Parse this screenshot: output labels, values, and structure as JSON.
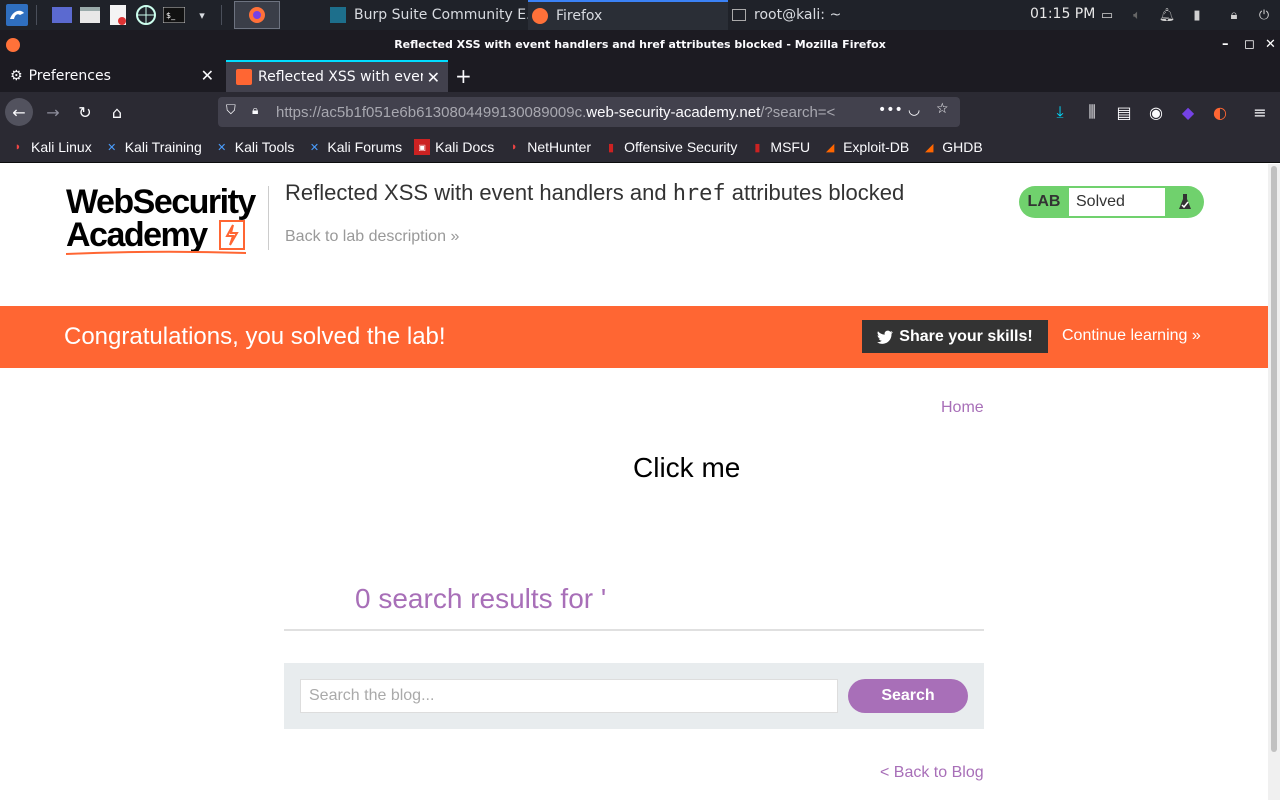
{
  "taskbar": {
    "tasks": [
      {
        "label": "Burp Suite Community E..."
      },
      {
        "label": "Firefox"
      },
      {
        "label": "root@kali: ~"
      }
    ],
    "clock": "01:15 PM"
  },
  "window": {
    "title": "Reflected XSS with event handlers and href attributes blocked - Mozilla Firefox"
  },
  "tabs": [
    {
      "label": "Preferences"
    },
    {
      "label": "Reflected XSS with event"
    }
  ],
  "urlbar": {
    "prefix": "https://ac5b1f051e6b6130804499130089009c.",
    "host": "web-security-academy.net",
    "suffix": "/?search=<"
  },
  "bookmarks": [
    {
      "label": "Kali Linux"
    },
    {
      "label": "Kali Training"
    },
    {
      "label": "Kali Tools"
    },
    {
      "label": "Kali Forums"
    },
    {
      "label": "Kali Docs"
    },
    {
      "label": "NetHunter"
    },
    {
      "label": "Offensive Security"
    },
    {
      "label": "MSFU"
    },
    {
      "label": "Exploit-DB"
    },
    {
      "label": "GHDB"
    }
  ],
  "header": {
    "logo_line1": "WebSecurity",
    "logo_line2": "Academy",
    "title_part1": "Reflected XSS with event handlers and ",
    "title_code": "href",
    "title_part2": " attributes blocked",
    "back_description": "Back to lab description",
    "lab_label": "LAB",
    "lab_status": "Solved"
  },
  "banner": {
    "message": "Congratulations, you solved the lab!",
    "share_label": "Share your skills!",
    "continue_label": "Continue learning"
  },
  "content": {
    "home_link": "Home",
    "click_me": "Click me",
    "results": "0 search results for '",
    "search_placeholder": "Search the blog...",
    "search_button": "Search",
    "back_blog": "< Back to Blog"
  },
  "colors": {
    "accent_orange": "#ff6633",
    "link_purple": "#a86fb8",
    "lab_green": "#70d16d"
  }
}
